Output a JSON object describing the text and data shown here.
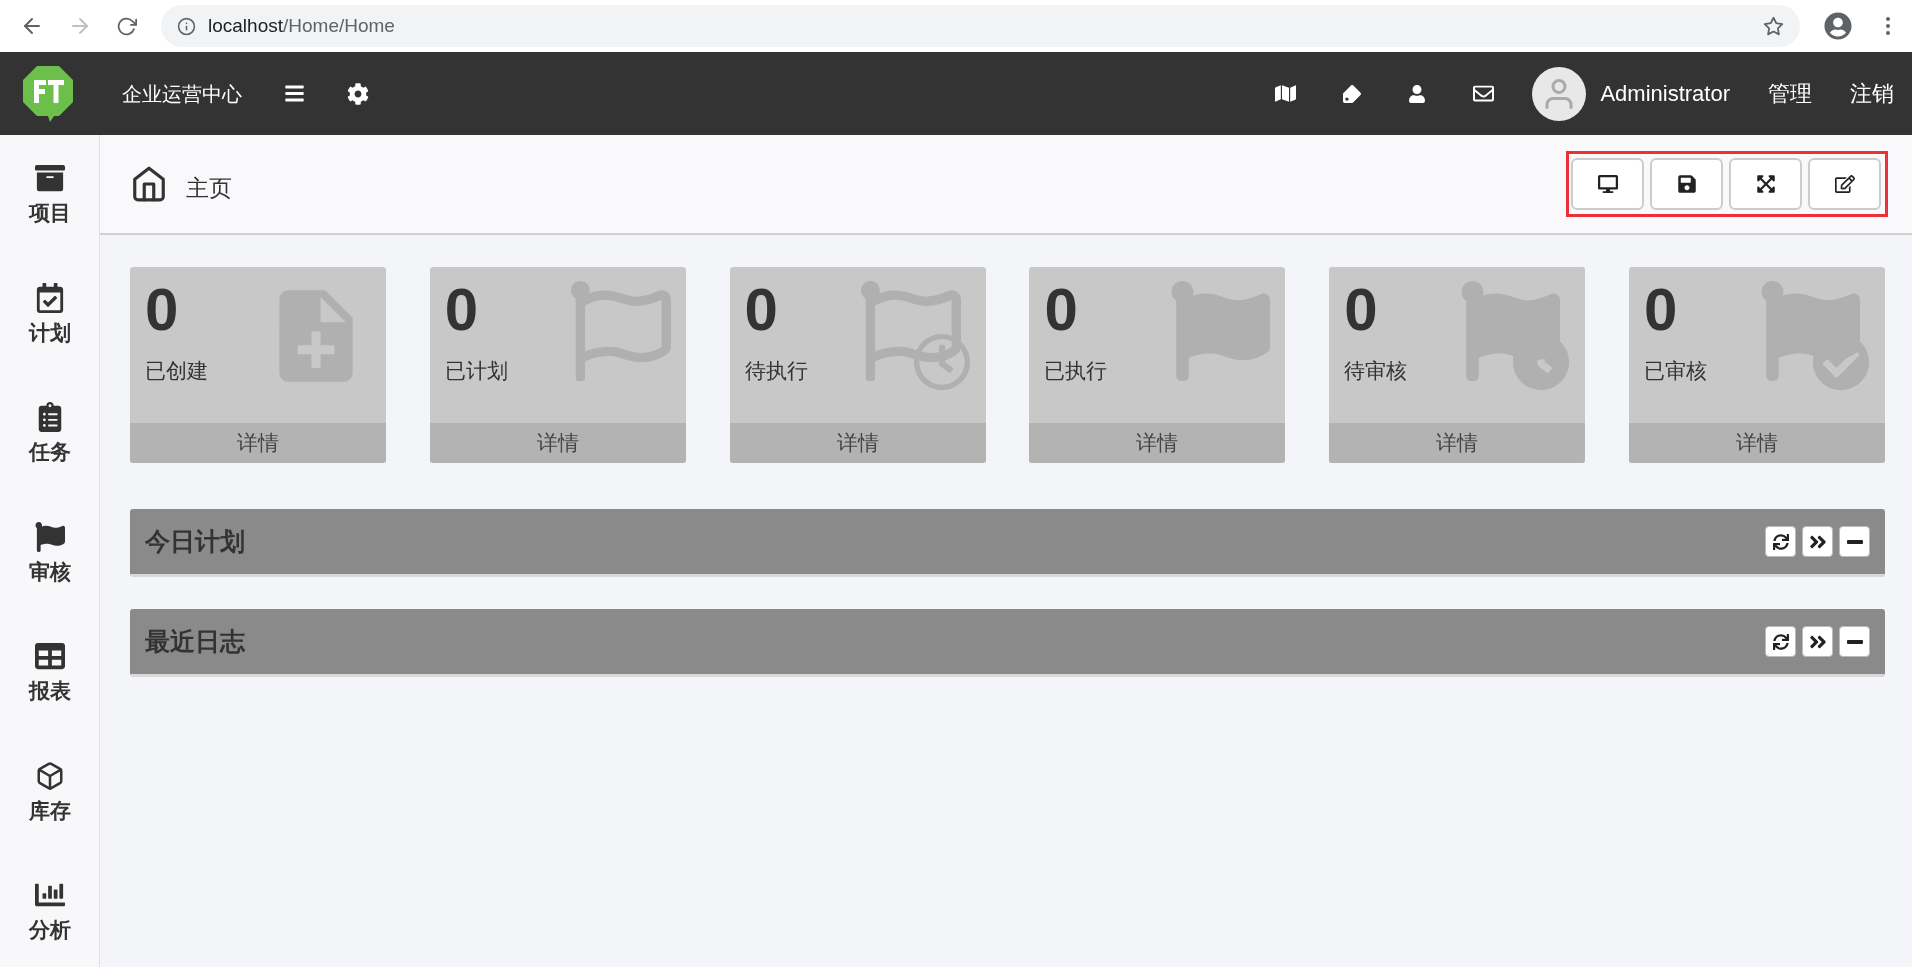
{
  "browser": {
    "url": "localhost/Home/Home"
  },
  "header": {
    "title": "企业运营中心",
    "user": "Administrator",
    "links": [
      "管理",
      "注销"
    ]
  },
  "sidebar": {
    "items": [
      {
        "label": "项目"
      },
      {
        "label": "计划"
      },
      {
        "label": "任务"
      },
      {
        "label": "审核"
      },
      {
        "label": "报表"
      },
      {
        "label": "库存"
      },
      {
        "label": "分析"
      }
    ]
  },
  "breadcrumb": {
    "label": "主页"
  },
  "cards": [
    {
      "count": "0",
      "label": "已创建",
      "link": "详情"
    },
    {
      "count": "0",
      "label": "已计划",
      "link": "详情"
    },
    {
      "count": "0",
      "label": "待执行",
      "link": "详情"
    },
    {
      "count": "0",
      "label": "已执行",
      "link": "详情"
    },
    {
      "count": "0",
      "label": "待审核",
      "link": "详情"
    },
    {
      "count": "0",
      "label": "已审核",
      "link": "详情"
    }
  ],
  "panels": [
    {
      "title": "今日计划"
    },
    {
      "title": "最近日志"
    }
  ]
}
